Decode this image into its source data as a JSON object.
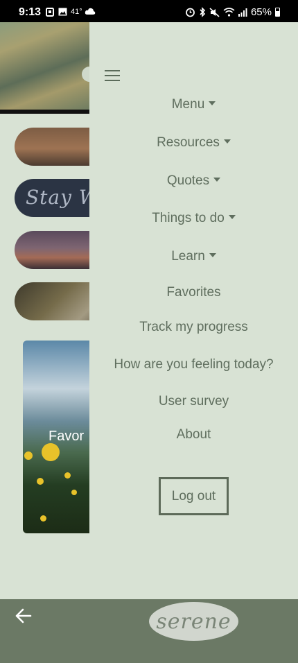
{
  "status_bar": {
    "time": "9:13",
    "temperature": "41°",
    "battery": "65%"
  },
  "background": {
    "favorites_label": "Favor",
    "quote_snippet": "Stay W"
  },
  "drawer": {
    "menu_items": [
      {
        "label": "Menu",
        "dropdown": true
      },
      {
        "label": "Resources",
        "dropdown": true
      },
      {
        "label": "Quotes",
        "dropdown": true
      },
      {
        "label": "Things to do",
        "dropdown": true
      },
      {
        "label": "Learn",
        "dropdown": true
      },
      {
        "label": "Favorites",
        "dropdown": false
      },
      {
        "label": "Track my progress",
        "dropdown": false
      },
      {
        "label": "How are you feeling today?",
        "dropdown": false
      },
      {
        "label": "User survey",
        "dropdown": false
      },
      {
        "label": "About",
        "dropdown": false
      }
    ],
    "logout_label": "Log out"
  },
  "bottom_bar": {
    "logo_text": "serene"
  },
  "colors": {
    "background": "#d8e2d4",
    "text": "#5f6e5e",
    "bottom_bar": "#6b7965",
    "logo_oval": "#d1d6ce"
  },
  "icons": {
    "hamburger": "hamburger-menu-icon",
    "back": "back-arrow-icon"
  }
}
